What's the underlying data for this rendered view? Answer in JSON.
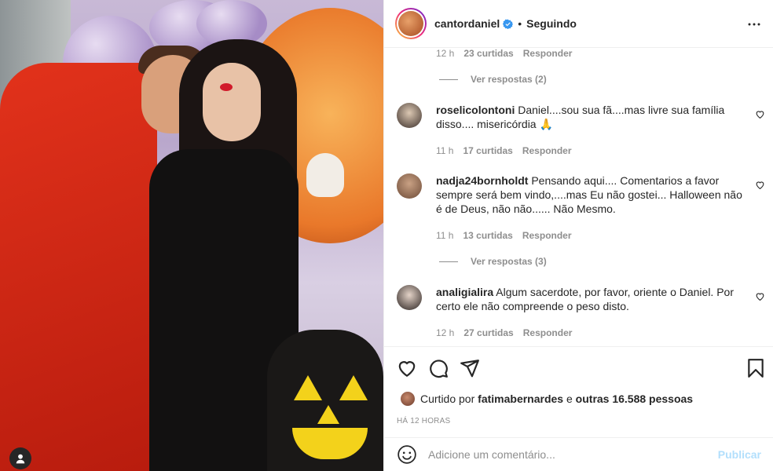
{
  "header": {
    "username": "cantordaniel",
    "separator": "•",
    "follow_status": "Seguindo"
  },
  "comments_list": {
    "first_meta": {
      "time": "12 h",
      "likes": "23 curtidas",
      "reply": "Responder"
    },
    "first_replies": "Ver respostas (2)",
    "items": [
      {
        "user": "roselicolontoni",
        "text": "Daniel....sou sua fã....mas livre sua família disso.... misericórdia 🙏",
        "time": "11 h",
        "likes": "17 curtidas",
        "reply": "Responder"
      },
      {
        "user": "nadja24bornholdt",
        "text": "Pensando aqui.... Comentarios a favor sempre será bem vindo,....mas Eu não gostei... Halloween não é de Deus, não não...... Não Mesmo.",
        "time": "11 h",
        "likes": "13 curtidas",
        "reply": "Responder"
      },
      {
        "user": "analigialira",
        "text": "Algum sacerdote, por favor, oriente o Daniel. Por certo ele não compreende o peso disto.",
        "time": "12 h",
        "likes": "27 curtidas",
        "reply": "Responder"
      }
    ],
    "second_replies": "Ver respostas (3)"
  },
  "likes": {
    "prefix": "Curtido por",
    "user": "fatimabernardes",
    "connector": "e",
    "others": "outras 16.588 pessoas"
  },
  "timestamp": "HÁ 12 HORAS",
  "add_comment": {
    "placeholder": "Adicione um comentário...",
    "publish": "Publicar"
  },
  "colors": {
    "text": "#262626",
    "muted": "#8e8e8e",
    "publish_disabled": "#b2dffc",
    "verified": "#3897f0"
  },
  "icons": [
    "user-tag-icon",
    "verified-icon",
    "more-icon",
    "heart-icon",
    "comment-icon",
    "share-icon",
    "bookmark-icon",
    "emoji-icon"
  ]
}
